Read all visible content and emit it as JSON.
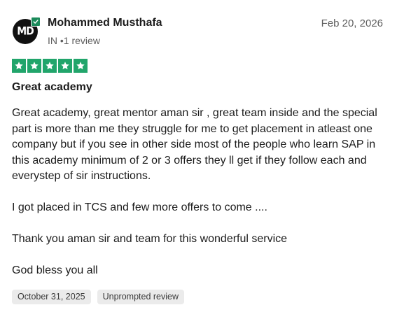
{
  "review": {
    "reviewer": {
      "name": "Mohammed Musthafa",
      "country": "IN",
      "separator": "•",
      "review_count": "1 review",
      "avatar_text": "MD",
      "verified": true
    },
    "date": "Feb 20, 2026",
    "rating": {
      "stars": 5,
      "max": 5,
      "color": "#21a56b"
    },
    "title": "Great academy",
    "paragraphs": [
      "Great academy, great mentor aman sir , great team inside and the special part is more than me they struggle for me to get placement in atleast one company but if you see in other side most of the people who learn SAP in this academy minimum of 2 or 3 offers they ll get if they follow each and everystep of sir instructions.",
      "I got placed in TCS and few more offers to come ....",
      "Thank you aman sir and team for this wonderful service",
      "God bless you all"
    ],
    "tags": {
      "experience_date": "October 31, 2025",
      "review_type": "Unprompted review"
    }
  },
  "colors": {
    "text_primary": "#1c1c1c",
    "text_secondary": "#5e5e5e",
    "tag_background": "#ebebeb",
    "verified_badge": "#1b8a5a"
  }
}
